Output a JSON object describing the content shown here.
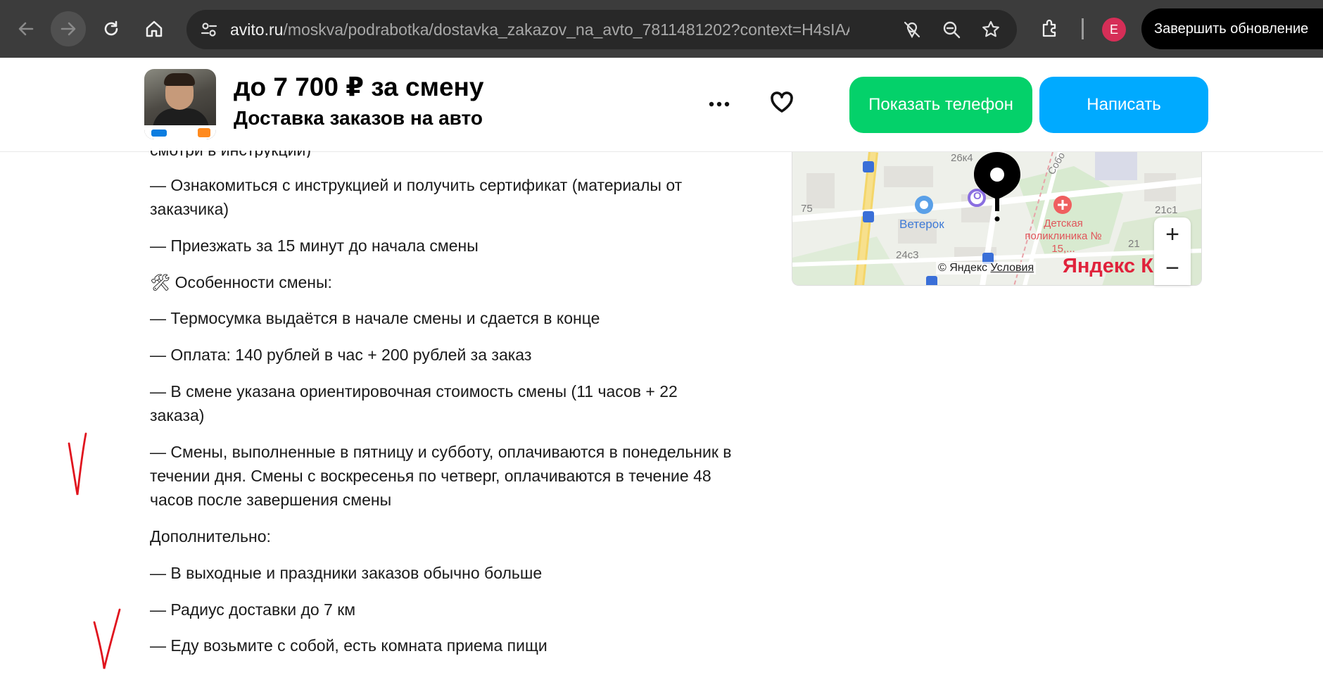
{
  "browser": {
    "url_host": "avito.ru",
    "url_path": "/moskva/podrabotka/dostavka_zakazov_na_avto_7811481202?context=H4sIAAA...",
    "profile_initial": "E",
    "update_label": "Завершить обновление"
  },
  "listing": {
    "price": "до 7 700 ₽ за смену",
    "title": "Доставка заказов на авто",
    "phone_button": "Показать телефон",
    "write_button": "Написать"
  },
  "description": {
    "clipped_line": "смотри в инструкции)",
    "lines": [
      "— Ознакомиться с инструкцией и получить сертификат (материалы от заказчика)",
      "— Приезжать за 15 минут до начала смены",
      "🛠 Особенности смены:",
      "— Термосумка выдаётся в начале смены и сдается в конце",
      "— Оплата: 140 рублей в час + 200 рублей за заказ",
      "— В смене указана ориентировочная стоимость смены (11 часов + 22 заказа)",
      "— Смены, выполненные в пятницу и субботу, оплачиваются в понедельник в течении дня. Смены с воскресенья по четверг, оплачиваются в течение 48 часов после завершения смены",
      "Дополнительно:",
      "— В выходные и праздники заказов обычно больше",
      "— Радиус доставки до 7 км",
      "— Еду возьмите с собой, есть комната приема пищи"
    ]
  },
  "map": {
    "labels": {
      "house_26k4": "26к4",
      "house_75": "75",
      "store": "Ветерок",
      "clinic": "Детская поликлиника № 15,...",
      "house_24s3": "24с3",
      "house_21s1": "21с1",
      "house_21": "21",
      "street": "Собо",
      "metro_letter": "О"
    },
    "attribution": "© Яндекс",
    "terms_link": "Условия",
    "logo": "Яндекс Карты",
    "zoom_in": "+",
    "zoom_out": "−"
  },
  "colors": {
    "phone_button": "#04d16a",
    "write_button": "#00aaff",
    "annotation": "#e0141e"
  }
}
